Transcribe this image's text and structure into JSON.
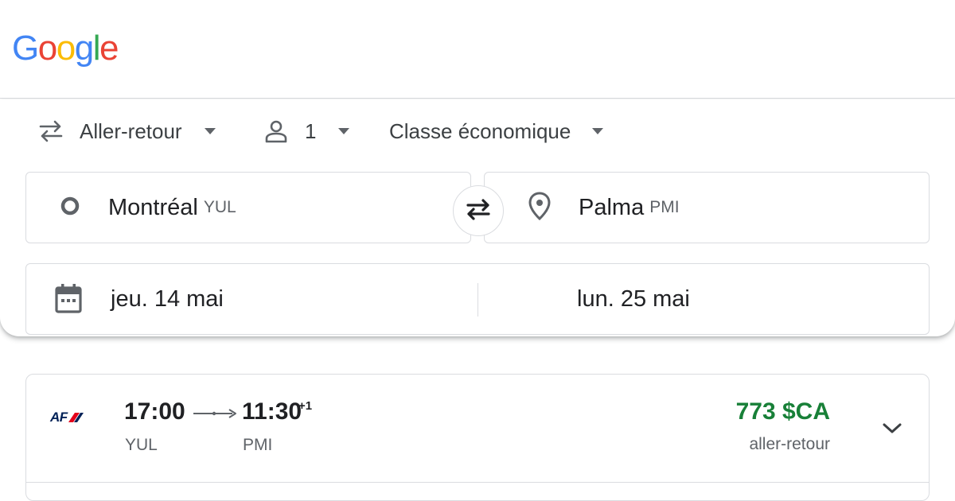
{
  "logo": {
    "letters": [
      "G",
      "o",
      "o",
      "g",
      "l",
      "e"
    ],
    "colors": [
      "#4285F4",
      "#EA4335",
      "#FBBC05",
      "#4285F4",
      "#34A853",
      "#EA4335"
    ]
  },
  "options": {
    "trip_type": "Aller-retour",
    "passengers": "1",
    "cabin_class": "Classe économique"
  },
  "origin": {
    "city": "Montréal",
    "code": "YUL"
  },
  "destination": {
    "city": "Palma",
    "code": "PMI"
  },
  "dates": {
    "departure": "jeu. 14 mai",
    "return": "lun. 25 mai"
  },
  "flight": {
    "airline_logo_text": "AF",
    "depart_time": "17:00",
    "arrive_time": "11:30",
    "day_offset": "+1",
    "depart_airport": "YUL",
    "arrive_airport": "PMI",
    "price": "773 $CA",
    "price_type": "aller-retour"
  },
  "colors": {
    "price_green": "#188038",
    "airfrance_navy": "#002157",
    "airfrance_red": "#E3001B"
  }
}
